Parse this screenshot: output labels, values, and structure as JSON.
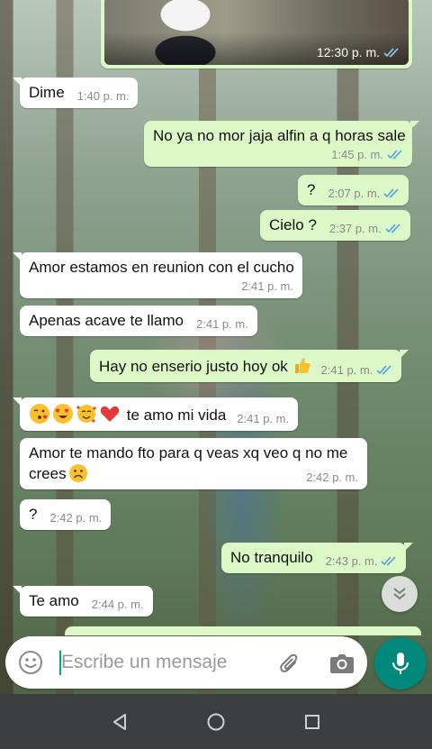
{
  "colors": {
    "incoming_bubble": "#ffffff",
    "outgoing_bubble": "#dcf8c6",
    "read_ticks": "#4fa3e0",
    "mic_button": "#00897b",
    "navbar": "#3c3f41"
  },
  "image_message": {
    "time": "12:30 p. m.",
    "status": "read"
  },
  "messages": [
    {
      "dir": "in",
      "text": "Dime",
      "time": "1:40 p. m."
    },
    {
      "dir": "out",
      "text": "No ya no mor jaja alfin a q horas sale",
      "time": "1:45 p. m.",
      "status": "read"
    },
    {
      "dir": "out",
      "text": "?",
      "time": "2:07 p. m.",
      "status": "read"
    },
    {
      "dir": "out",
      "text": "Cielo ?",
      "time": "2:37 p. m.",
      "status": "read"
    },
    {
      "dir": "in",
      "text": "Amor estamos en reunion con el cucho",
      "time": "2:41 p. m."
    },
    {
      "dir": "in",
      "text": "Apenas acave te llamo",
      "time": "2:41 p. m."
    },
    {
      "dir": "out",
      "text": "Hay no enserio justo hoy ok",
      "emoji": "thumbs-up",
      "time": "2:41 p. m.",
      "status": "read"
    },
    {
      "dir": "in",
      "emojis": [
        "kissing-heart",
        "heart-eyes",
        "smiling-hearts",
        "red-heart"
      ],
      "text": "te amo mi vida",
      "time": "2:41 p. m."
    },
    {
      "dir": "in",
      "text_line1": "Amor te mando fto para q veas xq veo q no me",
      "text_line2": "crees",
      "emoji": "frowning-face",
      "time": "2:42 p. m."
    },
    {
      "dir": "in",
      "text": "?",
      "time": "2:42 p. m."
    },
    {
      "dir": "out",
      "text": "No tranquilo",
      "time": "2:43 p. m.",
      "status": "read"
    },
    {
      "dir": "in",
      "text": "Te amo",
      "time": "2:44 p. m."
    }
  ],
  "composer": {
    "placeholder": "Escribe un mensaje",
    "emoji_icon": "smiley-icon",
    "attach_icon": "paperclip-icon",
    "camera_icon": "camera-icon",
    "send_icon": "microphone-icon"
  },
  "scroll_button_icon": "double-chevron-down-icon",
  "navbar": [
    "back-icon",
    "home-icon",
    "recents-icon"
  ]
}
